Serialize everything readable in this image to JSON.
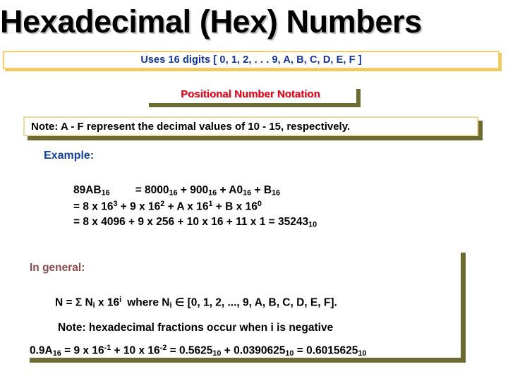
{
  "slide": {
    "title": "Hexadecimal (Hex) Numbers",
    "uses_banner": "Uses 16 digits [ 0, 1, 2, . . . 9, A, B, C, D, E, F ]",
    "notation_heading": "Positional Number Notation",
    "note": "Note: A - F represent the decimal values of 10 - 15, respectively."
  },
  "example": {
    "label": "Example:",
    "line1": {
      "lhs": "89AB",
      "lhs_sub": "16",
      "eq": "= 8000",
      "t1_sub": "16",
      "t2": " + 900",
      "t2_sub": "16",
      "t3": " + A0",
      "t3_sub": "16",
      "t4": " + B",
      "t4_sub": "16"
    },
    "line2": {
      "a": "= 8 x 16",
      "a_sup": "3",
      "b": " + 9 x 16",
      "b_sup": "2",
      "c": " + A x 16",
      "c_sup": "1",
      "d": " + B x 16",
      "d_sup": "0"
    },
    "line3": {
      "a": "= 8 x 4096 + 9 x 256 + 10 x 16 + 11 x 1 = 35243",
      "a_sub": "10"
    }
  },
  "general": {
    "label": "In general:",
    "formula": {
      "a": "N = ",
      "sigma": "Σ",
      "b": " N",
      "b_sub": "i",
      "c": " x 16",
      "c_sup": "i",
      "d": "where N",
      "d_sub": "i",
      "epsilon": " ∈ ",
      "e": "[0, 1, 2, ..., 9, A, B, C, D, E, F]."
    },
    "note": "Note: hexadecimal fractions occur when i is negative",
    "fraction": {
      "a": "0.9A",
      "a_sub": "16",
      "b": " = 9 x 16",
      "b_sup": "-1",
      "c": " + 10 x 16",
      "c_sup": "-2",
      "d": " = 0.5625",
      "d_sub": "10",
      "e": " + 0.0390625",
      "e_sub": "10",
      "f": " = 0.6015625",
      "f_sub": "10"
    }
  },
  "colors": {
    "title": "#000000",
    "banner_text": "#10349b",
    "banner_border": "#f3cd6a",
    "notation_text": "#e00018",
    "shadow_olive": "#6b6b33",
    "example_label": "#13429c",
    "general_label": "#8a4a4a"
  }
}
